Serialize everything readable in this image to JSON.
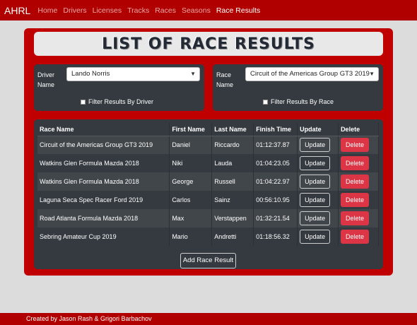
{
  "nav": {
    "brand": "AHRL",
    "links": [
      "Home",
      "Drivers",
      "Licenses",
      "Tracks",
      "Races",
      "Seasons",
      "Race Results"
    ]
  },
  "page_title": "LIST OF RACE RESULTS",
  "filters": {
    "driver": {
      "label": "Driver Name",
      "selected": "Lando Norris",
      "checkbox_label": "Filter Results By Driver"
    },
    "race": {
      "label": "Race Name",
      "selected": "Circuit of the Americas Group GT3 2019",
      "checkbox_label": "Filter Results By Race"
    }
  },
  "table": {
    "headers": [
      "Race Name",
      "First Name",
      "Last Name",
      "Finish Time",
      "Update",
      "Delete"
    ],
    "rows": [
      {
        "race": "Circuit of the Americas Group GT3 2019",
        "first": "Daniel",
        "last": "Riccardo",
        "time": "01:12:37.87"
      },
      {
        "race": "Watkins Glen Formula Mazda 2018",
        "first": "Niki",
        "last": "Lauda",
        "time": "01:04:23.05"
      },
      {
        "race": "Watkins Glen Formula Mazda 2018",
        "first": "George",
        "last": "Russell",
        "time": "01:04:22.97"
      },
      {
        "race": "Laguna Seca Spec Racer Ford 2019",
        "first": "Carlos",
        "last": "Sainz",
        "time": "00:56:10.95"
      },
      {
        "race": "Road Atlanta Formula Mazda 2018",
        "first": "Max",
        "last": "Verstappen",
        "time": "01:32:21.54"
      },
      {
        "race": "Sebring Amateur Cup 2019",
        "first": "Mario",
        "last": "Andretti",
        "time": "01:18:56.32"
      }
    ],
    "update_label": "Update",
    "delete_label": "Delete"
  },
  "add_button": "Add Race Result",
  "footer": "Created by Jason Rash & Grigori Barbachov",
  "colors": {
    "brand_red": "#b00000",
    "panel_red": "#c00000",
    "card_dark": "#343a40",
    "delete_red": "#dc3545"
  }
}
